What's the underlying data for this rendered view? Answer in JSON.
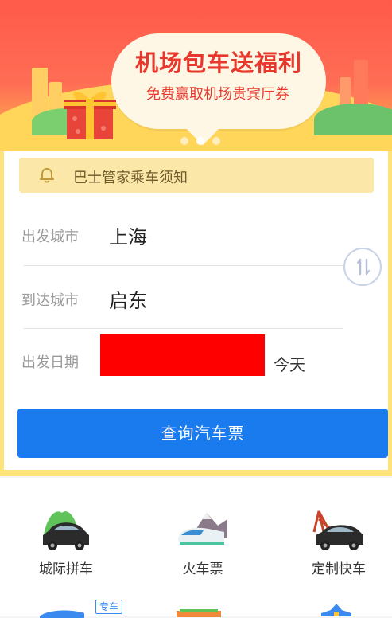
{
  "banner": {
    "title": "机场包车送福利",
    "subtitle": "免费赢取机场贵宾厅券",
    "slide_count": 3,
    "active_slide": 2
  },
  "notice": {
    "label": "巴士管家乘车须知",
    "icon": "bell-icon"
  },
  "form": {
    "departure_label": "出发城市",
    "departure_value": "上海",
    "arrival_label": "到达城市",
    "arrival_value": "启东",
    "date_label": "出发日期",
    "date_relative": "今天",
    "swap_icon": "swap-icon"
  },
  "search_button": "查询汽车票",
  "services": [
    {
      "label": "城际拼车",
      "icon": "intercity-carpool-icon"
    },
    {
      "label": "火车票",
      "icon": "train-icon"
    },
    {
      "label": "定制快车",
      "icon": "custom-express-car-icon"
    }
  ],
  "services_row2": {
    "badge": "专车"
  },
  "colors": {
    "primary": "#1a7bef",
    "notice_bg": "#fbe7a8",
    "banner_red": "#e8382d",
    "card_border": "#ffe27a"
  }
}
